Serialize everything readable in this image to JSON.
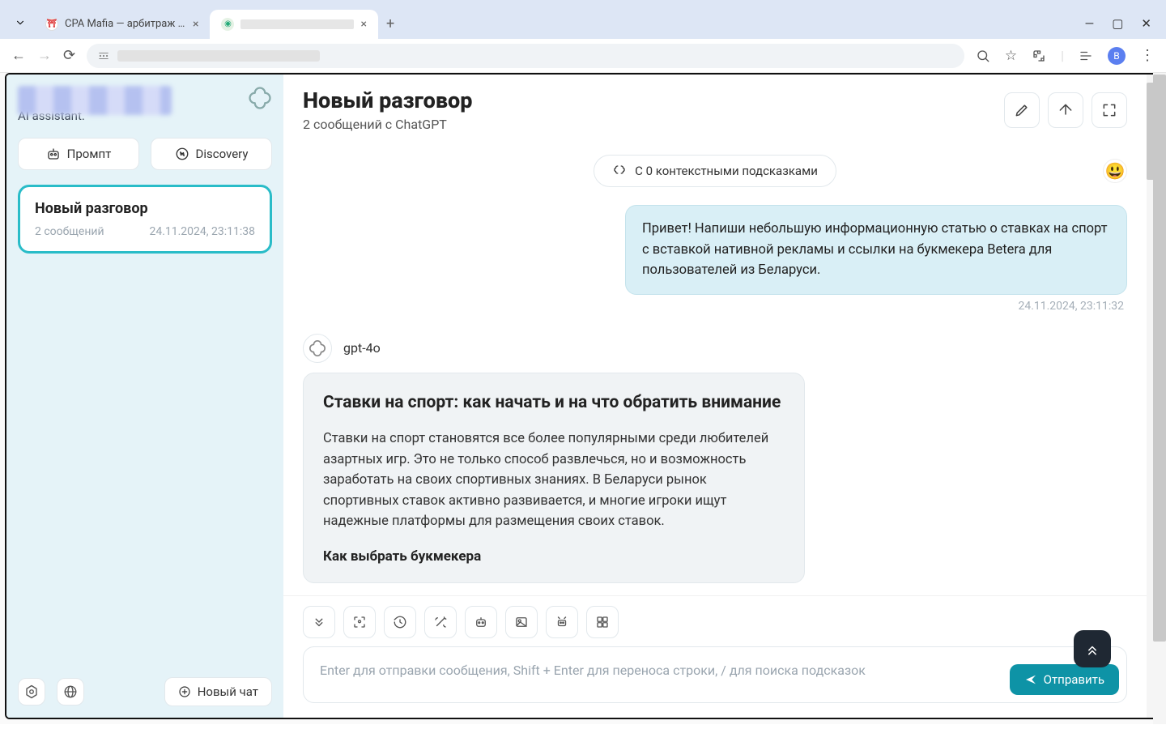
{
  "browser": {
    "tabs": [
      {
        "title": "CPA Mafia — арбитраж трафик"
      },
      {
        "title": ""
      }
    ],
    "avatar_letter": "В"
  },
  "sidebar": {
    "subtitle": "AI assistant.",
    "buttons": {
      "prompt": "Промпт",
      "discovery": "Discovery"
    },
    "card": {
      "title": "Новый разговор",
      "count": "2 сообщений",
      "timestamp": "24.11.2024, 23:11:38"
    },
    "new_chat": "Новый чат"
  },
  "main": {
    "title": "Новый разговор",
    "subtitle": "2 сообщений с ChatGPT",
    "context_pill": "С 0 контекстными подсказками",
    "user_message": "Привет! Напиши небольшую информационную статью о ставках на спорт с вставкой нативной рекламы и ссылки на букмекера Betera для пользователей из Беларуси.",
    "user_ts": "24.11.2024, 23:11:32",
    "assistant_name": "gpt-4o",
    "assistant_heading": "Ставки на спорт: как начать и на что обратить внимание",
    "assistant_p1": "Ставки на спорт становятся все более популярными среди любителей азартных игр. Это не только способ развлечься, но и возможность заработать на своих спортивных знаниях. В Беларуси рынок спортивных ставок активно развивается, и многие игроки ищут надежные платформы для размещения своих ставок.",
    "assistant_h2": "Как выбрать букмекера",
    "input_placeholder": "Enter для отправки сообщения, Shift + Enter для переноса строки, / для поиска подсказок",
    "send_label": "Отправить",
    "emoji": "😃"
  }
}
